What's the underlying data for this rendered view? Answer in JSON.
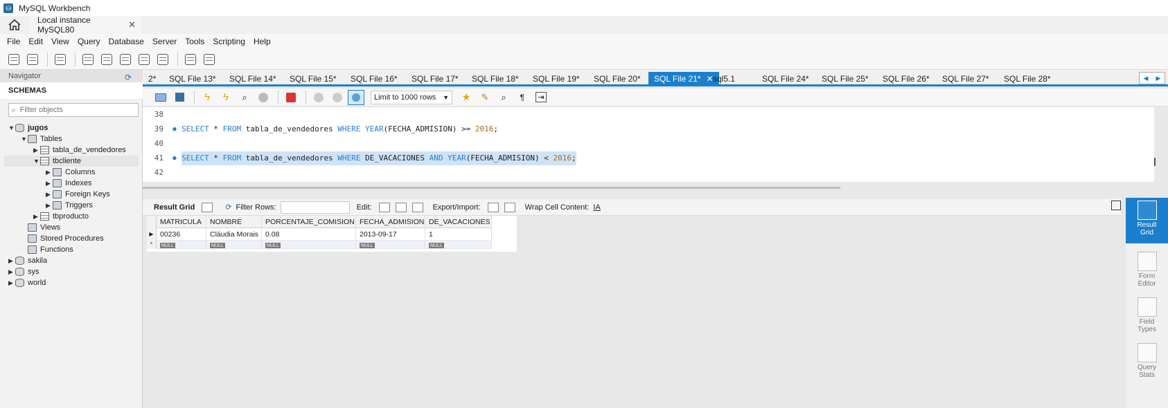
{
  "window": {
    "title": "MySQL Workbench",
    "connection_tab": "Local instance MySQL80"
  },
  "menu": [
    "File",
    "Edit",
    "View",
    "Query",
    "Database",
    "Server",
    "Tools",
    "Scripting",
    "Help"
  ],
  "navigator": {
    "header": "Navigator",
    "schemas_label": "SCHEMAS",
    "filter_placeholder": "Filter objects",
    "tree": [
      {
        "label": "jugos",
        "bold": true
      },
      {
        "label": "Tables"
      },
      {
        "label": "tabla_de_vendedores"
      },
      {
        "label": "tbcliente"
      },
      {
        "label": "Columns"
      },
      {
        "label": "Indexes"
      },
      {
        "label": "Foreign Keys"
      },
      {
        "label": "Triggers"
      },
      {
        "label": "tbproducto"
      },
      {
        "label": "Views"
      },
      {
        "label": "Stored Procedures"
      },
      {
        "label": "Functions"
      },
      {
        "label": "sakila"
      },
      {
        "label": "sys"
      },
      {
        "label": "world"
      }
    ]
  },
  "sql_tabs": [
    "2*",
    "SQL File 13*",
    "SQL File 14*",
    "SQL File 15*",
    "SQL File 16*",
    "SQL File 17*",
    "SQL File 18*",
    "SQL File 19*",
    "SQL File 20*",
    "SQL File 21*",
    "sql5.1",
    "SQL File 24*",
    "SQL File 25*",
    "SQL File 26*",
    "SQL File 27*",
    "SQL File 28*"
  ],
  "active_tab_index": 9,
  "editor_toolbar": {
    "limit": "Limit to 1000 rows"
  },
  "code": [
    {
      "n": "38",
      "dot": false,
      "parts": []
    },
    {
      "n": "39",
      "dot": true,
      "parts": [
        {
          "t": "SELECT",
          "k": "kw"
        },
        {
          "t": " * ",
          "k": ""
        },
        {
          "t": "FROM",
          "k": "kw"
        },
        {
          "t": " tabla_de_vendedores ",
          "k": ""
        },
        {
          "t": "WHERE",
          "k": "kw"
        },
        {
          "t": " ",
          "k": ""
        },
        {
          "t": "YEAR",
          "k": "kw"
        },
        {
          "t": "(FECHA_ADMISION) >= ",
          "k": ""
        },
        {
          "t": "2016",
          "k": "num"
        },
        {
          "t": ";",
          "k": ""
        }
      ]
    },
    {
      "n": "40",
      "dot": false,
      "parts": []
    },
    {
      "n": "41",
      "dot": true,
      "selected": true,
      "parts": [
        {
          "t": "SELECT",
          "k": "kw"
        },
        {
          "t": " * ",
          "k": ""
        },
        {
          "t": "FROM",
          "k": "kw"
        },
        {
          "t": " tabla_de_vendedores ",
          "k": ""
        },
        {
          "t": "WHERE",
          "k": "kw"
        },
        {
          "t": " DE_VACACIONES ",
          "k": ""
        },
        {
          "t": "AND",
          "k": "kw"
        },
        {
          "t": " ",
          "k": ""
        },
        {
          "t": "YEAR",
          "k": "kw"
        },
        {
          "t": "(FECHA_ADMISION) < ",
          "k": ""
        },
        {
          "t": "2016",
          "k": "num"
        },
        {
          "t": ";",
          "k": ""
        }
      ]
    },
    {
      "n": "42",
      "dot": false,
      "parts": []
    }
  ],
  "result_toolbar": {
    "result_grid": "Result Grid",
    "filter_rows": "Filter Rows:",
    "edit": "Edit:",
    "export_import": "Export/Import:",
    "wrap": "Wrap Cell Content:"
  },
  "grid": {
    "columns": [
      "MATRICULA",
      "NOMBRE",
      "PORCENTAJE_COMISION",
      "FECHA_ADMISION",
      "DE_VACACIONES"
    ],
    "rows": [
      [
        "00236",
        "Cláudia Morais",
        "0.08",
        "2013-09-17",
        "1"
      ]
    ],
    "null_label": "NULL"
  },
  "side_panel": [
    {
      "label": "Result\nGrid",
      "active": true
    },
    {
      "label": "Form\nEditor",
      "active": false
    },
    {
      "label": "Field\nTypes",
      "active": false
    },
    {
      "label": "Query\nStats",
      "active": false
    }
  ],
  "colors": {
    "accent": "#1b7fcd",
    "keyword": "#2d7fd6",
    "number": "#b5661b",
    "selection": "#cfe3f6"
  }
}
